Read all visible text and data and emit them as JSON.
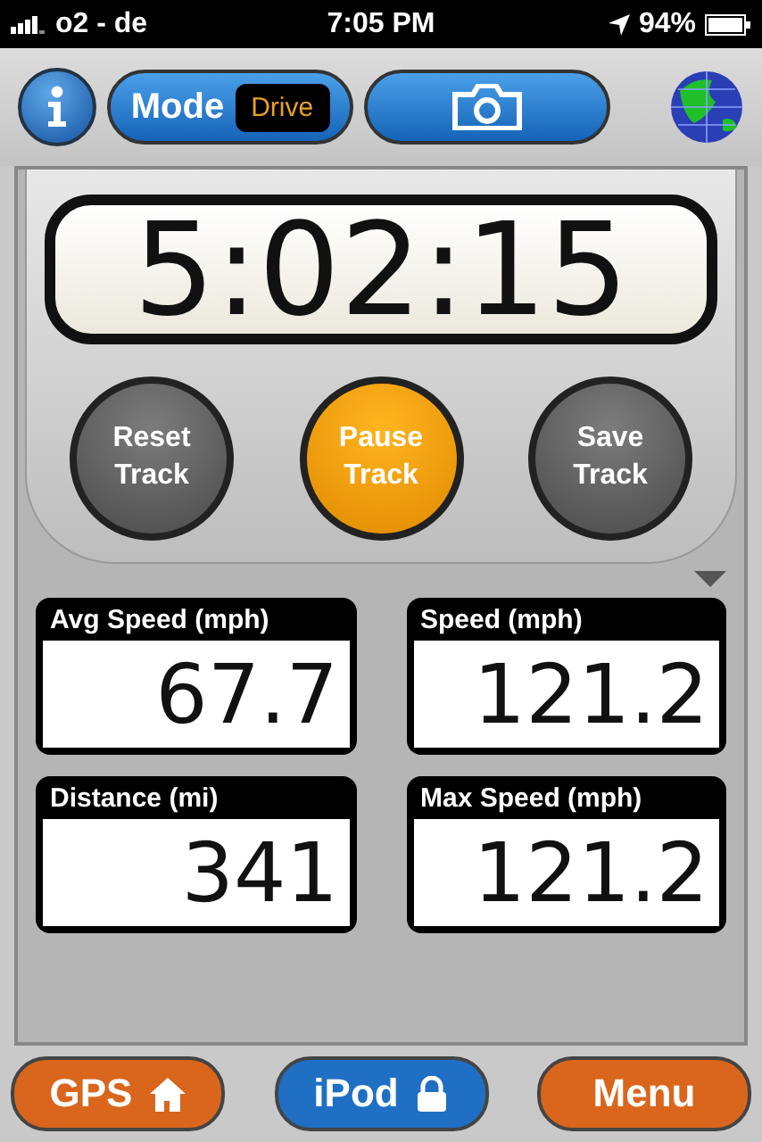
{
  "status_bar": {
    "carrier": "o2 - de",
    "time": "7:05 PM",
    "battery": "94%"
  },
  "toolbar": {
    "mode_label": "Mode",
    "mode_value": "Drive"
  },
  "timer": "5:02:15",
  "track_buttons": [
    {
      "label": "Reset Track",
      "highlighted": false
    },
    {
      "label": "Pause Track",
      "highlighted": true
    },
    {
      "label": "Save Track",
      "highlighted": false
    }
  ],
  "stats": [
    {
      "label": "Avg Speed (mph)",
      "value": "67.7"
    },
    {
      "label": "Speed (mph)",
      "value": "121.2"
    },
    {
      "label": "Distance (mi)",
      "value": "341"
    },
    {
      "label": "Max Speed (mph)",
      "value": "121.2"
    }
  ],
  "bottom_buttons": [
    {
      "label": "GPS",
      "kind": "home",
      "color": "#d9661c"
    },
    {
      "label": "iPod",
      "kind": "lock",
      "color": "#1f6fc4"
    },
    {
      "label": "Menu",
      "kind": "plain",
      "color": "#d9661c"
    }
  ]
}
